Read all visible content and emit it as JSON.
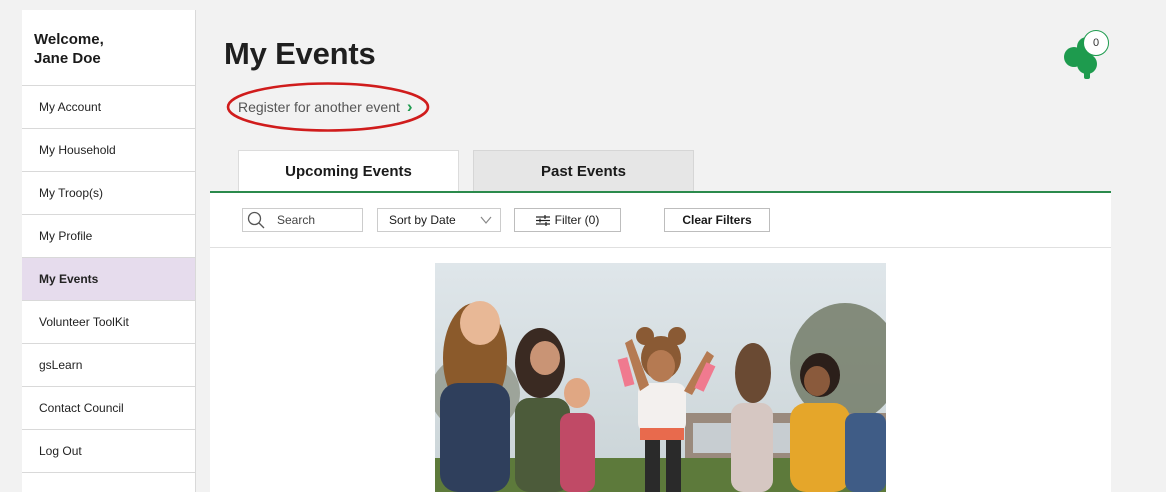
{
  "sidebar": {
    "welcome_line1": "Welcome,",
    "welcome_line2": "Jane Doe",
    "items": [
      {
        "label": "My Account"
      },
      {
        "label": "My Household"
      },
      {
        "label": "My Troop(s)"
      },
      {
        "label": "My Profile"
      },
      {
        "label": "My Events",
        "active": true
      },
      {
        "label": "Volunteer ToolKit"
      },
      {
        "label": "gsLearn"
      },
      {
        "label": "Contact Council"
      },
      {
        "label": "Log Out"
      }
    ]
  },
  "header": {
    "title": "My Events",
    "register_link": "Register for another event",
    "notification_count": "0",
    "logo_icon": "trefoil-icon"
  },
  "tabs": [
    {
      "label": "Upcoming Events",
      "selected": true
    },
    {
      "label": "Past Events",
      "selected": false
    }
  ],
  "filters": {
    "search_placeholder": "Search",
    "sort_value": "Sort by Date",
    "filter_label": "Filter (0)",
    "clear_label": "Clear Filters"
  },
  "colors": {
    "brand_green": "#1e9b4e",
    "active_nav_bg": "#e6dced",
    "annotation_red": "#d01c1c"
  }
}
